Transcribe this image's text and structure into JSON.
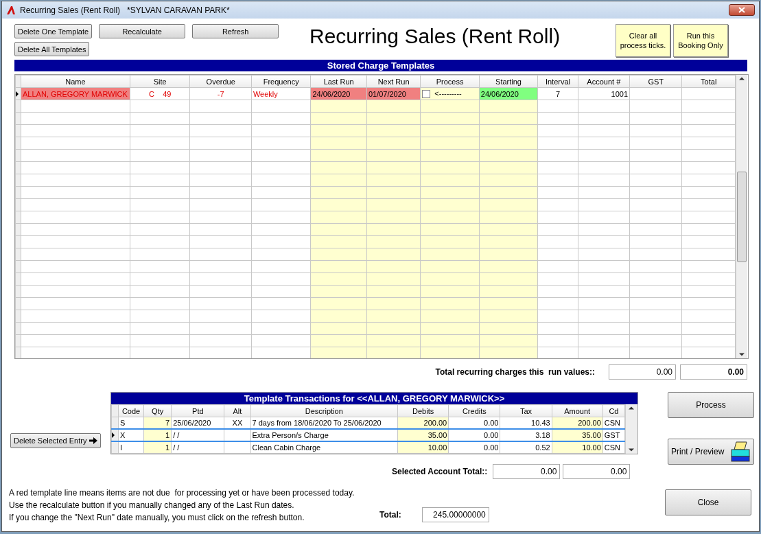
{
  "window": {
    "title": "Recurring Sales (Rent Roll)   *SYLVAN CARAVAN PARK*"
  },
  "toolbar": {
    "row_1": [
      "Delete One Template",
      "Recalculate",
      "Refresh"
    ],
    "row_2": [
      "Delete All Templates"
    ]
  },
  "heading": "Recurring Sales (Rent Roll)",
  "action_buttons": [
    "Clear all process ticks.",
    "Run this Booking Only"
  ],
  "templates": {
    "title": "Stored Charge Templates",
    "columns": [
      "Name",
      "Site",
      "Overdue",
      "Frequency",
      "Last Run",
      "Next Run",
      "Process",
      "Starting",
      "Interval",
      "Account #",
      "GST",
      "Total"
    ],
    "rows": [
      {
        "name": "ALLAN, GREGORY MARWICK",
        "site": "C    49",
        "overdue": "-7",
        "frequency": "Weekly",
        "last_run": "24/06/2020",
        "next_run": "01/07/2020",
        "process_checked": false,
        "process_arrow": "<---------",
        "starting": "24/06/2020",
        "interval": "7",
        "account": "1001",
        "due": false,
        "selected": true
      }
    ]
  },
  "run_totals": {
    "label": "Total recurring charges this  run values::",
    "values": [
      "0.00",
      "0.00"
    ]
  },
  "transactions": {
    "title": "Template Transactions for <<ALLAN, GREGORY MARWICK>>",
    "columns": [
      "Code",
      "Qty",
      "Ptd",
      "Alt",
      "Description",
      "Debits",
      "Credits",
      "Tax",
      "Amount",
      "Cd"
    ],
    "rows": [
      {
        "code": "S",
        "qty": "7",
        "ptd": "25/06/2020",
        "alt": "XX",
        "description": "7 days from 18/06/2020 To 25/06/2020",
        "debits": "200.00",
        "credits": "0.00",
        "tax": "10.43",
        "amount": "200.00",
        "cd": "CSN",
        "selected": false
      },
      {
        "code": "X",
        "qty": "1",
        "ptd": "/ /",
        "description": "Extra Person/s Charge",
        "debits": "35.00",
        "credits": "0.00",
        "tax": "3.18",
        "amount": "35.00",
        "cd": "GST",
        "selected": true
      },
      {
        "code": "I",
        "qty": "1",
        "ptd": "/ /",
        "description": "Clean Cabin Charge",
        "debits": "10.00",
        "credits": "0.00",
        "tax": "0.52",
        "amount": "10.00",
        "cd": "CSN",
        "selected": false
      }
    ]
  },
  "delete_entry_button": "Delete Selected Entry",
  "selected_total": {
    "label": "Selected Account Total::",
    "values": [
      "0.00",
      "0.00"
    ]
  },
  "notes": [
    "A red template line means items are not due  for processing yet or have been processed today.",
    "Use the recalculate button if you manually changed any of the Last Run dates.",
    "If you change the \"Next Run\" date manually, you must click on the refresh button."
  ],
  "total": {
    "label": "Total:",
    "value": "245.00000000"
  },
  "side_buttons": {
    "process": "Process",
    "print": "Print / Preview",
    "close": "Close"
  }
}
